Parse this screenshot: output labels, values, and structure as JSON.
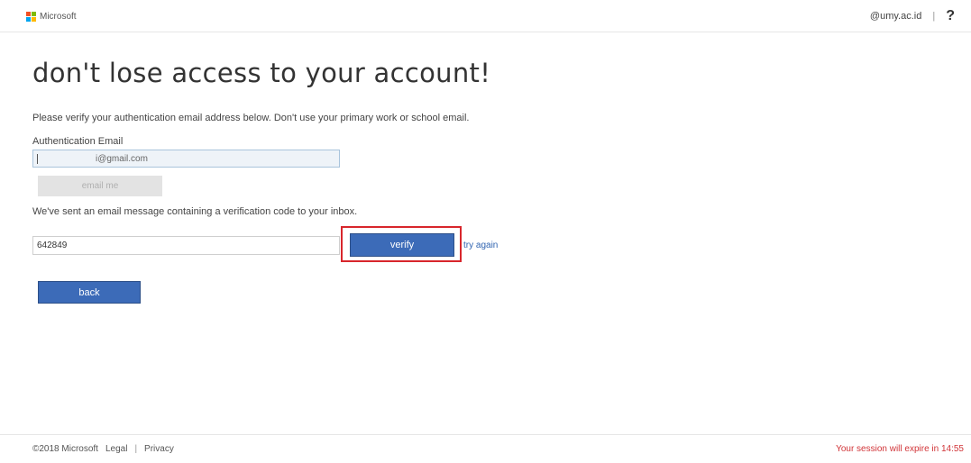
{
  "header": {
    "brand": "Microsoft",
    "account": "@umy.ac.id",
    "separator": "|",
    "help": "?"
  },
  "main": {
    "title": "don't lose access to your account!",
    "instructions": "Please verify your authentication email address below. Don't use your primary work or school email.",
    "email_label": "Authentication Email",
    "email_value": "i@gmail.com",
    "email_me_label": "email me",
    "sent_message": "We've sent an email message containing a verification code to your inbox.",
    "code_value": "642849",
    "verify_label": "verify",
    "try_again_label": "try again",
    "back_label": "back"
  },
  "footer": {
    "copyright": "©2018 Microsoft",
    "legal": "Legal",
    "separator": "|",
    "privacy": "Privacy",
    "session": "Your session will expire in 14:55"
  },
  "colors": {
    "primary_button": "#3c6bb8",
    "highlight": "#d8262c",
    "link": "#2f63b0",
    "session_text": "#d13438"
  },
  "icons": {
    "logo": "microsoft-logo-icon",
    "help": "question-mark-icon"
  }
}
